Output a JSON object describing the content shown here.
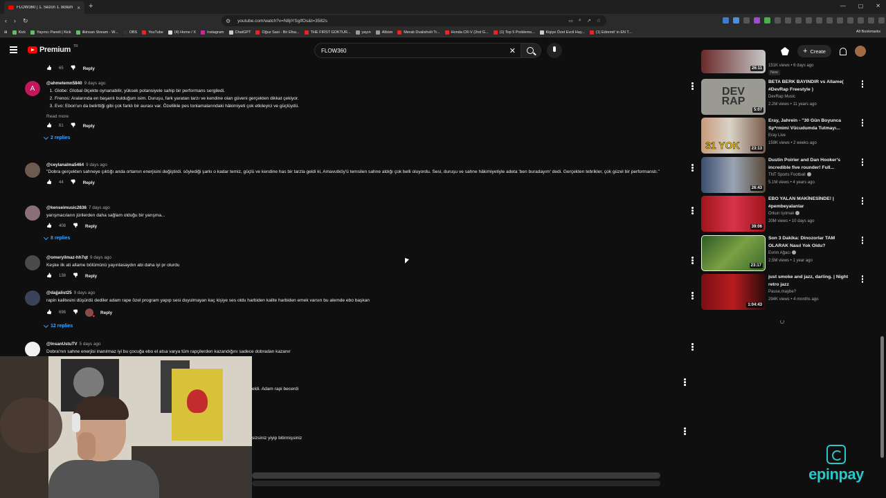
{
  "browser": {
    "tab_title": "FLOW360 | 1. Sezon 1. Bölüm | S",
    "url": "youtube.com/watch?v=N8jiYSgIfOs&t=3582s",
    "bookmarks": [
      "Kick",
      "Yayıncı Paneli | Kick",
      "ilkinsan Stream - W...",
      "OBS",
      "YouTube",
      "(4) Home / X",
      "Instagram",
      "ChatGPT",
      "Oğuz Sasi - Bir Efsa...",
      "THE FIRST GOKTUR...",
      "yayın",
      "Albüm",
      "Merab Dvalishvili Tr...",
      "Honda CR-V (2nd G...",
      "(1) Top 5 Problems...",
      "Kişiye Özel Evcil Hay...",
      "(1) Edremit' in EN T..."
    ],
    "all_bookmarks": "All Bookmarks"
  },
  "masthead": {
    "logo_text": "Premium",
    "logo_sup": "TR",
    "search_value": "FLOW360",
    "create_label": "Create"
  },
  "comments": [
    {
      "handle": "",
      "time": "",
      "text": "",
      "likes": "65",
      "reply": "Reply",
      "replies": ""
    },
    {
      "avatar_letter": "A",
      "handle": "@ahmetemn5840",
      "time": "9 days ago",
      "list": [
        "Globe: Global ölçekte oynanabilir, yüksek potansiyele sahip bir performans sergiledi.",
        "Frenos: Aralarında en başarılı bulduğum isim. Duruşu, fark yaratan tarzı ve kendine olan güveni gerçekten dikkat çekiyor.",
        "Evo: Ebon'un da belirttiği gibi çok farklı bir aurası var. Özellikle pes tonlamalarındaki hâkimiyeti çok etkileyici ve güçlüydü."
      ],
      "read_more": "Read more",
      "likes": "61",
      "reply": "Reply",
      "replies": "2 replies"
    },
    {
      "handle": "@ceylanalma5464",
      "time": "9 days ago",
      "text": "\"Dobra gerçekten sahneye çıktığı anda ortamın enerjisini değiştirdi. söylediği şarkı o kadar temiz, güçlü ve kendine has bir tarzla geldi ki, Amavutköy'ü temsilen sahne aldığı çok belli oluyordu. Sesi, duruşu ve sahne hâkimiyetiyle adeta 'ben buradayım' dedi. Gerçekten tebrikler, çok güzel bir performanstı.\"",
      "likes": "44",
      "reply": "Reply",
      "replies": ""
    },
    {
      "handle": "@kenseimusic2636",
      "time": "7 days ago",
      "text": "yarışmacıların jürilerden daha sağlam olduğu bir yarışma...",
      "likes": "408",
      "reply": "Reply",
      "replies": "8 replies"
    },
    {
      "handle": "@omeryilmaz-hh7qt",
      "time": "9 days ago",
      "text": "Keşke ilk ati allame bölümünü yayınlasaydın abi daha iyi pr olurdu",
      "likes": "138",
      "reply": "Reply",
      "replies": ""
    },
    {
      "handle": "@dajjalist25",
      "time": "9 days ago",
      "text": "rapin kalitesini düşürdü dediler adam rape özel program yapıp sesi duyulmayan kaç kişiye ses oldu harbiden kalite harbiden emek varsın bu alemde ebo başkan",
      "likes": "698",
      "reply": "Reply",
      "replies": "12 replies"
    },
    {
      "handle": "@InsanUstuTV",
      "time": "5 days ago",
      "text": "Dobra'nın sahne enerjisi inanılmaz iyi bu çocuğa ebo el atsa varya tüm rapçilerden kazandığını sadece dobradan kazanır",
      "likes": "",
      "reply": "",
      "replies": ""
    }
  ],
  "fragments": [
    "eldi. Adam rapi becerdi",
    "sizsiniz yiyip bitirmişsiniz"
  ],
  "sidebar": [
    {
      "title": "",
      "channel": "",
      "meta": "151K views • 6 days ago",
      "badge": "New",
      "duration": "26:11"
    },
    {
      "title": "BETA BERK BAYINDIR vs Allame( #DevRap Freestyle )",
      "channel": "DevRap Music",
      "meta": "2.2M views • 11 years ago",
      "duration": "5:07",
      "thumb_text": "DEV RAP"
    },
    {
      "title": "Eray, Jahrein - \"30 Gün Boyunca Sp*rmimi Vücudumda Tutmayı...",
      "channel": "Eray Live",
      "meta": "159K views • 2 weeks ago",
      "duration": "23:13",
      "thumb_text": "31 YOK"
    },
    {
      "title": "Dustin Poirier and Dan Hooker's incredible five rounder! Full...",
      "channel": "TNT Sports Football",
      "meta": "5.1M views • 4 years ago",
      "duration": "26:43"
    },
    {
      "title": "EBO YALAN MAKİNESİNDE! | #pembeyalanlar",
      "channel": "Orkun Işıtmak",
      "meta": "20M views • 10 days ago",
      "duration": "39:06"
    },
    {
      "title": "Son 3 Dakika: Dinozorlar TAM OLARAK Nasıl Yok Oldu?",
      "channel": "Evrim Ağacı",
      "meta": "2.5M views • 1 year ago",
      "duration": "23:17"
    },
    {
      "title": "just smoke and jazz, darling. | Night retro jazz",
      "channel": "Pause,maybe?",
      "meta": "294K views • 4 months ago",
      "duration": "1:04:43"
    }
  ],
  "overlay": {
    "brand": "epinpay"
  },
  "colors": {
    "background": "#0f0f0f",
    "link_blue": "#3ea6ff",
    "brand_red": "#ff0000",
    "epinpay_teal": "#29c7c7"
  }
}
